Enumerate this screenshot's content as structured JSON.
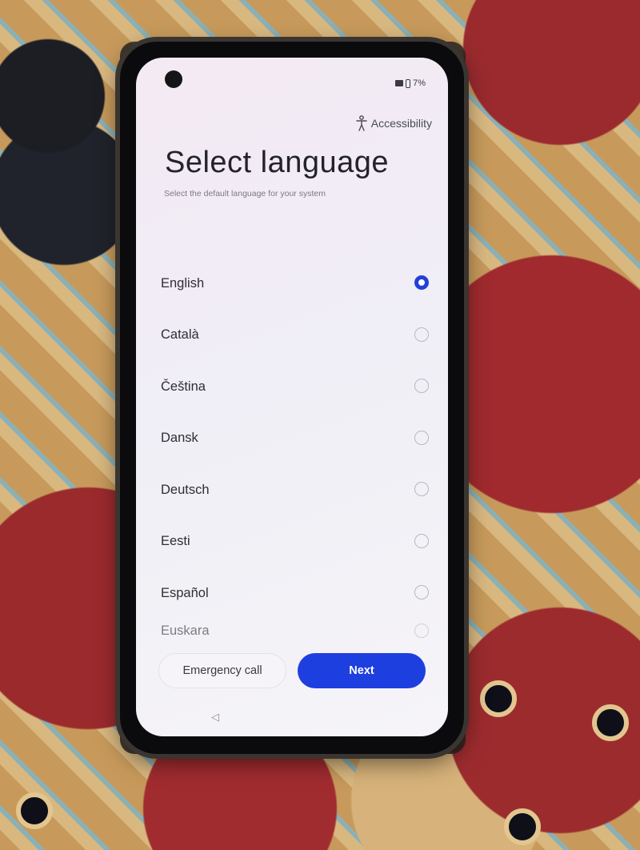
{
  "status_bar": {
    "battery": "7%"
  },
  "header": {
    "accessibility_label": "Accessibility",
    "title": "Select language",
    "subtitle": "Select the default language for your system"
  },
  "languages": [
    {
      "label": "English",
      "selected": true
    },
    {
      "label": "Català",
      "selected": false
    },
    {
      "label": "Čeština",
      "selected": false
    },
    {
      "label": "Dansk",
      "selected": false
    },
    {
      "label": "Deutsch",
      "selected": false
    },
    {
      "label": "Eesti",
      "selected": false
    },
    {
      "label": "Español",
      "selected": false
    },
    {
      "label": "Euskara",
      "selected": false
    }
  ],
  "footer": {
    "emergency_label": "Emergency call",
    "next_label": "Next",
    "back_glyph": "◁"
  },
  "colors": {
    "accent": "#1e3fe0"
  }
}
